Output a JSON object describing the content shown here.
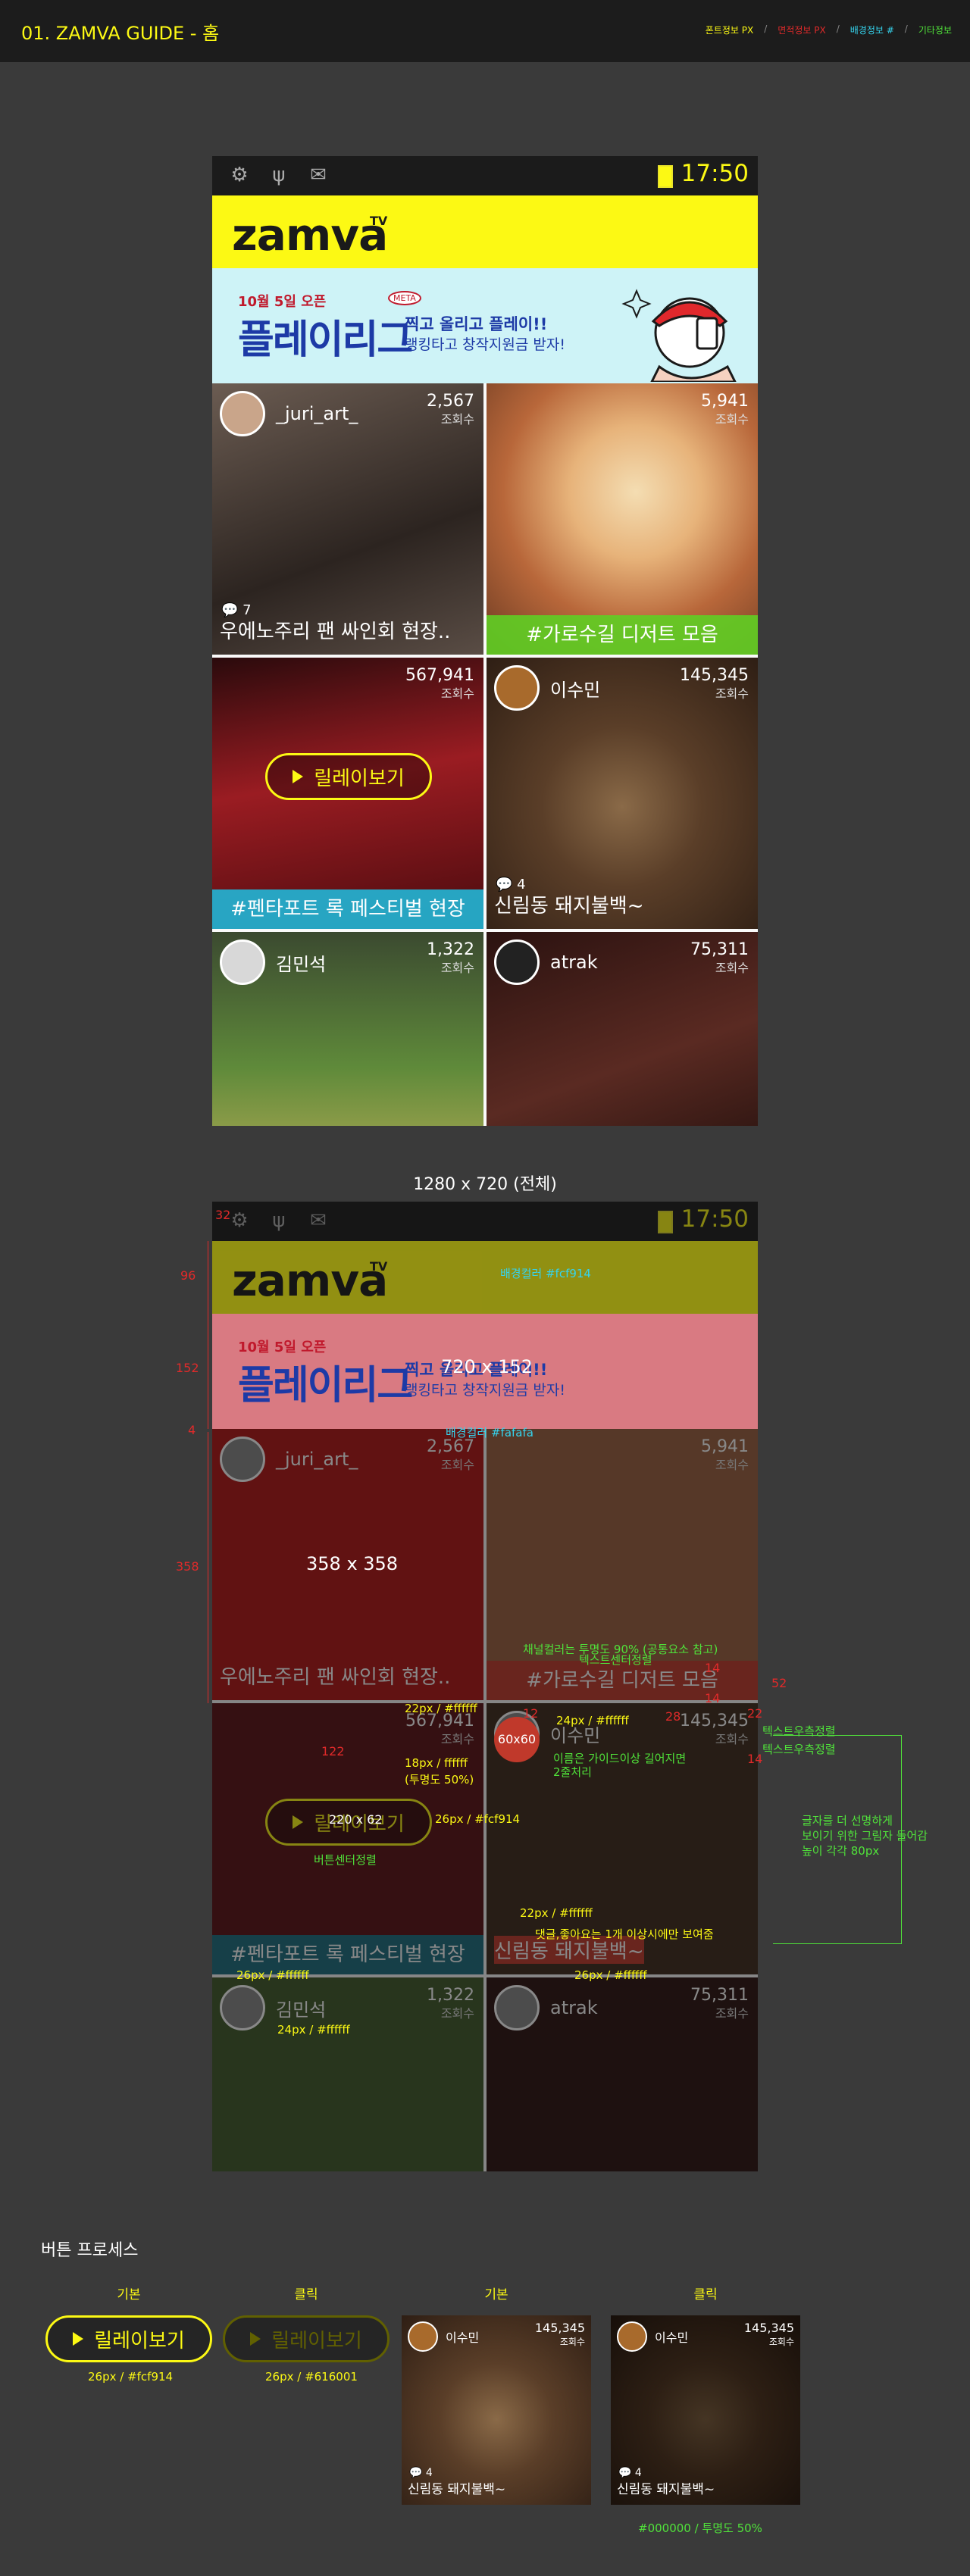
{
  "header": {
    "title": "01. ZAMVA GUIDE - 홈",
    "legend": [
      {
        "label": "폰트정보 PX",
        "color": "#fcf914"
      },
      {
        "label": "면적정보 PX",
        "color": "#e02a2a"
      },
      {
        "label": "배경정보 #",
        "color": "#35d4ee"
      },
      {
        "label": "기타정보",
        "color": "#50e23a"
      }
    ],
    "legend_sep": "/"
  },
  "phone": {
    "time": "17:50",
    "status_icons": [
      "android-icon",
      "usb-icon",
      "mail-icon"
    ],
    "logo": "zamva",
    "logo_tv": "TV",
    "banner": {
      "date": "10월 5일 오픈",
      "headline": "플레이리그",
      "badge": "META",
      "line1": "찍고 올리고 플레이!!",
      "line2": "랭킹타고 창작지원금 받자!"
    },
    "relay_button": "릴레이보기",
    "tiles": [
      {
        "user": "_juri_art_",
        "views": "2,567",
        "views_label": "조회수",
        "comments": "7",
        "caption": "우에노주리 팬 싸인회 현장..",
        "bar": "",
        "bg": "#3a302c"
      },
      {
        "user": "",
        "views": "5,941",
        "views_label": "조회수",
        "comments": "",
        "caption": "",
        "bar": "#가로수길 디저트 모음",
        "bar_color": "#5fce23",
        "bg": "#b8673a"
      },
      {
        "user": "",
        "views": "567,941",
        "views_label": "조회수",
        "comments": "",
        "caption": "",
        "bar": "#펜타포트 록 페스티벌 현장",
        "bar_color": "#21b6d6",
        "bg": "#7a1418"
      },
      {
        "user": "이수민",
        "views": "145,345",
        "views_label": "조회수",
        "comments": "4",
        "caption": "신림동 돼지불백~",
        "bar": "",
        "bg": "#4e3524"
      },
      {
        "user": "김민석",
        "views": "1,322",
        "views_label": "조회수",
        "comments": "",
        "caption": "",
        "bar": "",
        "bg": "#4d6b34"
      },
      {
        "user": "atrak",
        "views": "75,311",
        "views_label": "조회수",
        "comments": "",
        "caption": "",
        "bar": "",
        "bg": "#3a1a18"
      }
    ]
  },
  "caption_full": "1280 x 720 (전체)",
  "spec": {
    "s32": "32",
    "s96": "96",
    "logo_bg": "배경컬러 #fcf914",
    "s152": "152",
    "banner_size": "720 x 152",
    "s4": "4",
    "grid_bg": "배경컬러 #fafafa",
    "s358": "358",
    "tile_size": "358 x 358",
    "channel_note": "채널컬러는 투명도 90% (공통요소 참고)",
    "text_center": "텍스트센터정렬",
    "s14a": "14",
    "s52": "52",
    "s14b": "14",
    "font22_white": "22px / #ffffff",
    "font24_white": "24px / #ffffff",
    "s12": "12",
    "s28": "28",
    "s22": "22",
    "s122": "122",
    "font18_white": "18px / ffffff",
    "opacity50": "(투명도 50%)",
    "avatar_size": "60x60",
    "name_note_1": "이름은 가이드이상 길어지면",
    "name_note_2": "2줄처리",
    "s14c": "14",
    "text_right_1": "텍스트우측정렬",
    "text_right_2": "텍스트우측정렬",
    "btn_size": "220 x 62",
    "btn_font": "26px / #fcf914",
    "btn_center": "버튼센터정렬",
    "readability_1": "글자를 더 선명하게",
    "readability_2": "보이기 위한 그림자 들어감",
    "readability_3": "높이 각각 80px",
    "font22_white_b": "22px / #ffffff",
    "comment_note": "댓글,좋아요는 1개 이상시에만 보여줌",
    "font26_white_a": "26px / #ffffff",
    "font26_white_b": "26px / #ffffff",
    "font24_white_b": "24px / #ffffff"
  },
  "buttons": {
    "title": "버튼 프로세스",
    "default_label": "기본",
    "click_label": "클릭",
    "default_note": "26px / #fcf914",
    "click_note": "26px / #616001",
    "thumb_default_label": "기본",
    "thumb_click_label": "클릭",
    "thumb_click_note": "#000000 / 투명도 50%"
  }
}
